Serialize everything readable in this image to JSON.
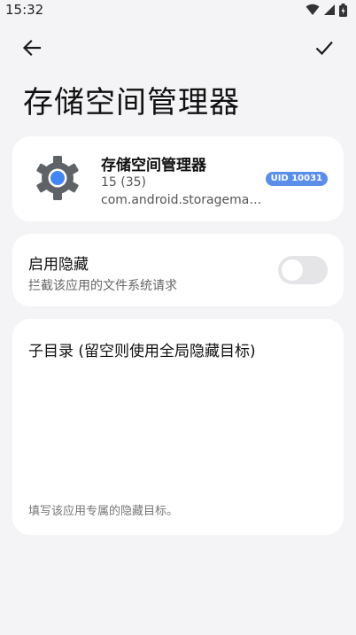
{
  "status_bar": {
    "time": "15:32",
    "icons": [
      "wifi-icon",
      "signal-icon",
      "battery-icon"
    ]
  },
  "top_bar": {
    "back_icon": "arrow-left-icon",
    "confirm_icon": "check-icon"
  },
  "page": {
    "title": "存储空间管理器"
  },
  "app_card": {
    "icon": "gear-icon",
    "name": "存储空间管理器",
    "version": "15 (35)",
    "package": "com.android.storagemana...",
    "uid_badge": "UID 10031"
  },
  "redirect_toggle": {
    "title": "启用隐藏",
    "description": "拦截该应用的文件系统请求",
    "enabled": false
  },
  "subdir": {
    "label": "子目录 (留空则使用全局隐藏目标)",
    "value": "",
    "hint": "填写该应用专属的隐藏目标。"
  },
  "colors": {
    "background": "#f4f4f6",
    "card": "#ffffff",
    "badge": "#5b8ee8",
    "switch_off": "#e5e5e8"
  }
}
